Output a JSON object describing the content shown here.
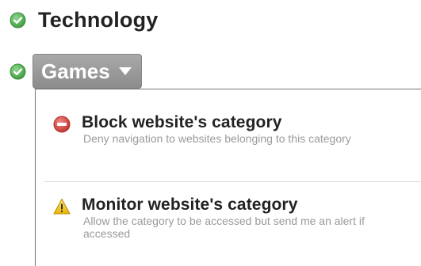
{
  "categories": [
    {
      "label": "Technology"
    },
    {
      "label": "Games"
    }
  ],
  "dropdown": {
    "options": [
      {
        "title": "Block website's category",
        "description": "Deny navigation to websites belonging to this category",
        "icon": "block-icon"
      },
      {
        "title": "Monitor website's category",
        "description": "Allow the category to be accessed but send me an alert if accessed",
        "icon": "warning-icon"
      }
    ]
  },
  "colors": {
    "check_green": "#5cb85c",
    "pill_gray": "#999999",
    "block_red": "#d9534f",
    "warning_yellow": "#f0c419",
    "description_gray": "#9a9a9a"
  }
}
